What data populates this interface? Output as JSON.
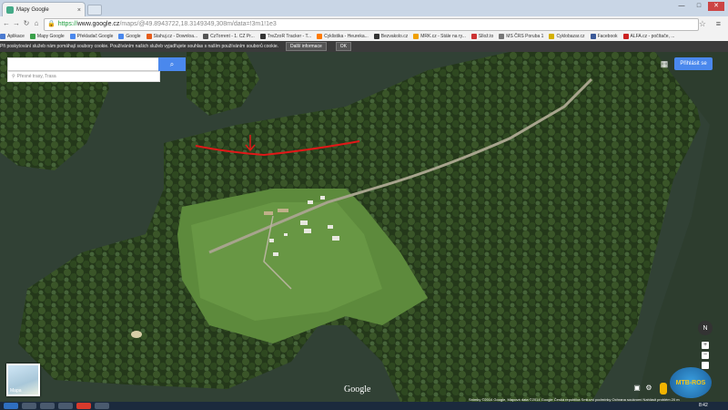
{
  "browser": {
    "tab_title": "Mapy Google",
    "url_prefix": "https://",
    "url_host": "www.google.cz",
    "url_path": "/maps/@49.8943722,18.3149349,308m/data=!3m1!1e3",
    "win_min": "—",
    "win_max": "□",
    "win_close": "✕"
  },
  "bookmarks": [
    {
      "label": "Aplikace",
      "color": "#4a7ad0"
    },
    {
      "label": "Mapy Google",
      "color": "#3aa04a"
    },
    {
      "label": "Překladač Google",
      "color": "#4a88ed"
    },
    {
      "label": "Google",
      "color": "#4a88ed"
    },
    {
      "label": "Stahuj.cz - Downloa...",
      "color": "#e65c1a"
    },
    {
      "label": "CzTorrent - 1. CZ Pr...",
      "color": "#555555"
    },
    {
      "label": "TreZzoR Tracker - T...",
      "color": "#333333"
    },
    {
      "label": "Cyklistika - Heureka...",
      "color": "#ff7a00"
    },
    {
      "label": "Bezvakolo.cz",
      "color": "#333333"
    },
    {
      "label": "MRK.cz - Stále na ry...",
      "color": "#f0a000"
    },
    {
      "label": "Sllož.to",
      "color": "#cc3333"
    },
    {
      "label": "MS ČRS Poruba 1",
      "color": "#777777"
    },
    {
      "label": "Cyklobazar.cz",
      "color": "#d4b000"
    },
    {
      "label": "Facebook",
      "color": "#3b5998"
    },
    {
      "label": "ALFA.cz - počítače, ...",
      "color": "#cc2222"
    }
  ],
  "cookie": {
    "text": "Při poskytování služeb nám pomáhají soubory cookie. Používáním našich služeb vyjadřujete souhlas s naším používáním souborů cookie.",
    "more_label": "Další informace",
    "ok_label": "OK"
  },
  "map": {
    "search_placeholder": "",
    "search_icon": "search-icon",
    "suggest_text": "Přesné trasy, Trasa",
    "signin_label": "Přihlásit se",
    "thumbnail_label": "Mapa",
    "logo_text": "Google",
    "attribution": "Snímky ©2014 Google, Mapová data ©2014 Google   Česká republika   Smluvní podmínky   Ochrana soukromí   Nahlásit problém   20 m",
    "compass_label": "N",
    "zoom_in": "+",
    "zoom_out": "−",
    "watermark_text": "MTB-ROS"
  },
  "taskbar": {
    "clock": "8:42"
  }
}
